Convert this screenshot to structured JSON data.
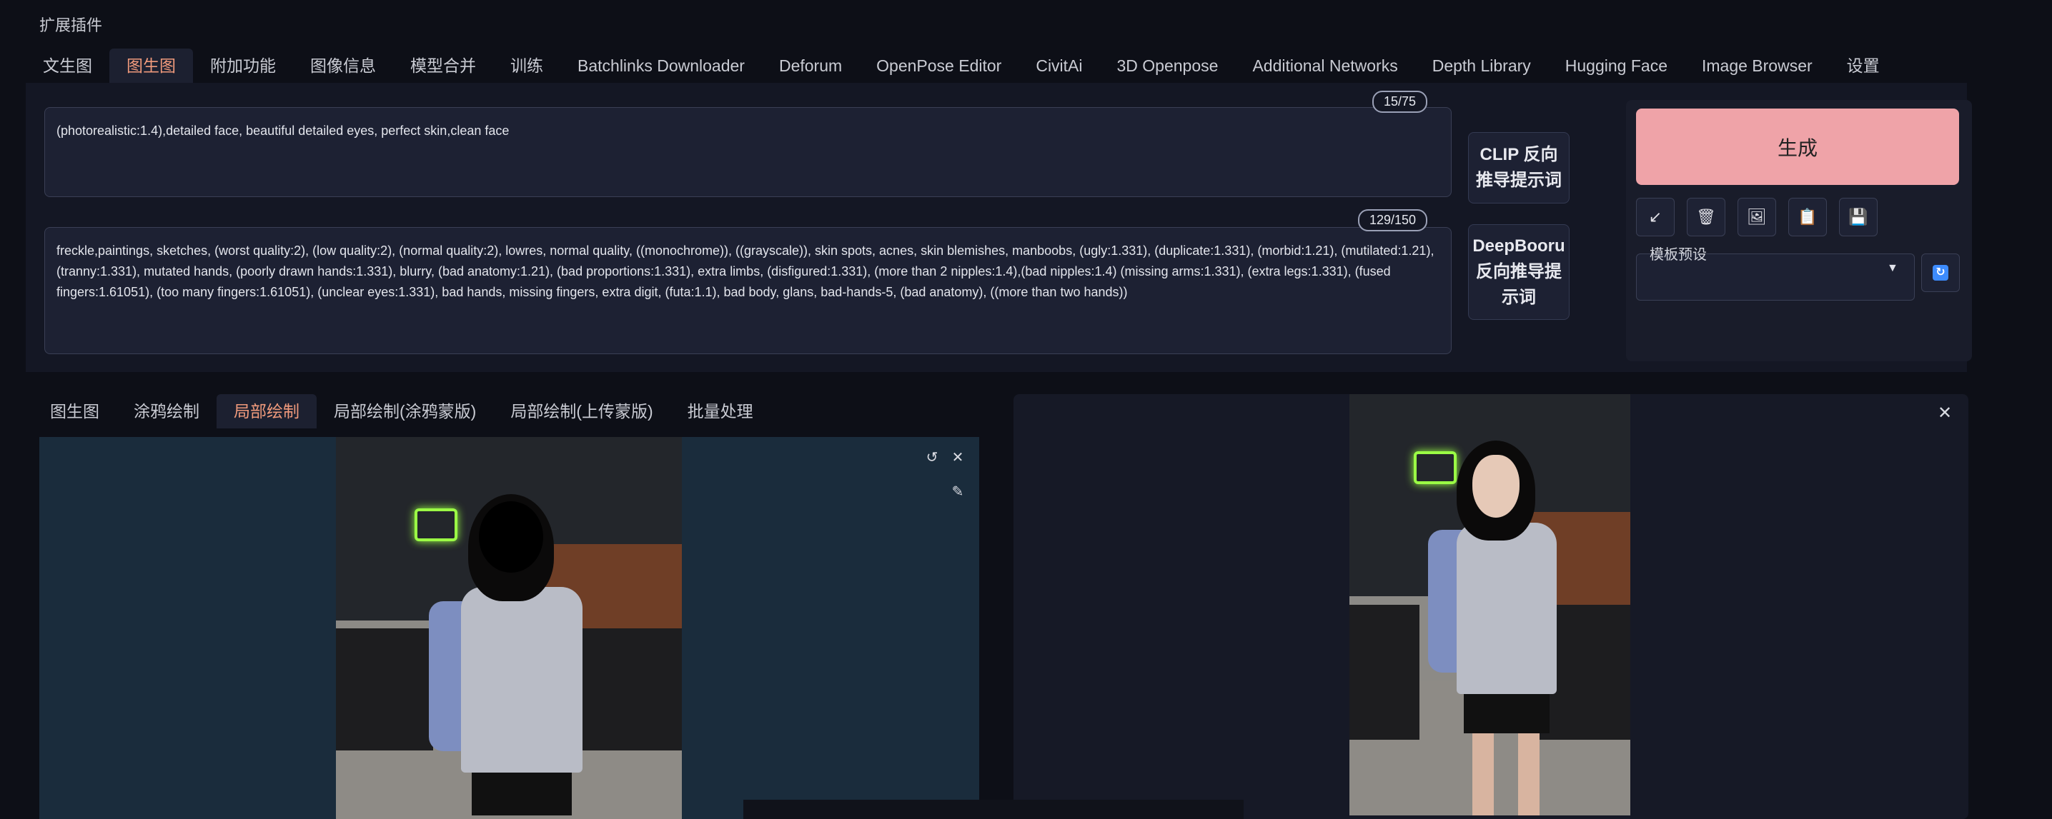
{
  "app": {
    "section_title": "扩展插件"
  },
  "main_tabs": [
    {
      "label": "文生图",
      "active": false
    },
    {
      "label": "图生图",
      "active": true
    },
    {
      "label": "附加功能",
      "active": false
    },
    {
      "label": "图像信息",
      "active": false
    },
    {
      "label": "模型合并",
      "active": false
    },
    {
      "label": "训练",
      "active": false
    },
    {
      "label": "Batchlinks Downloader",
      "active": false
    },
    {
      "label": "Deforum",
      "active": false
    },
    {
      "label": "OpenPose Editor",
      "active": false
    },
    {
      "label": "CivitAi",
      "active": false
    },
    {
      "label": "3D Openpose",
      "active": false
    },
    {
      "label": "Additional Networks",
      "active": false
    },
    {
      "label": "Depth Library",
      "active": false
    },
    {
      "label": "Hugging Face",
      "active": false
    },
    {
      "label": "Image Browser",
      "active": false
    },
    {
      "label": "设置",
      "active": false
    }
  ],
  "prompt": {
    "positive": "(photorealistic:1.4),detailed face, beautiful detailed eyes, perfect skin,clean face",
    "positive_counter": "15/75",
    "negative": "freckle,paintings, sketches, (worst quality:2), (low quality:2), (normal quality:2), lowres, normal quality, ((monochrome)), ((grayscale)), skin spots, acnes, skin blemishes, manboobs, (ugly:1.331), (duplicate:1.331), (morbid:1.21), (mutilated:1.21), (tranny:1.331), mutated hands, (poorly drawn hands:1.331), blurry, (bad anatomy:1.21), (bad proportions:1.331), extra limbs, (disfigured:1.331), (more than 2 nipples:1.4),(bad nipples:1.4) (missing arms:1.331), (extra legs:1.331), (fused fingers:1.61051), (too many fingers:1.61051), (unclear eyes:1.331), bad hands, missing fingers, extra digit, (futa:1.1), bad body, glans, bad-hands-5, (bad anatomy), ((more than two hands))",
    "negative_counter": "129/150"
  },
  "interrogate": {
    "clip_label": "CLIP 反向推导提示词",
    "deepbooru_label": "DeepBooru 反向推导提示词"
  },
  "actions": {
    "generate_label": "生成",
    "tools": [
      {
        "icon": "arrow-icon",
        "glyph": "↙"
      },
      {
        "icon": "trash-icon",
        "glyph": "🗑"
      },
      {
        "icon": "image-icon",
        "glyph": "🖼"
      },
      {
        "icon": "clipboard-icon",
        "glyph": "📋"
      },
      {
        "icon": "save-icon",
        "glyph": "💾"
      }
    ],
    "style_preset_label": "模板预设",
    "style_preset_value": ""
  },
  "sub_tabs": [
    {
      "label": "图生图",
      "active": false
    },
    {
      "label": "涂鸦绘制",
      "active": false
    },
    {
      "label": "局部绘制",
      "active": true
    },
    {
      "label": "局部绘制(涂鸦蒙版)",
      "active": false
    },
    {
      "label": "局部绘制(上传蒙版)",
      "active": false
    },
    {
      "label": "批量处理",
      "active": false
    }
  ],
  "canvas": {
    "undo_glyph": "↺",
    "close_glyph": "✕",
    "brush_glyph": "✎"
  },
  "output": {
    "close_glyph": "✕"
  },
  "colors": {
    "accent_tab": "#f09a7c",
    "generate_bg": "#efa3a8",
    "refresh": "#3d8bfd"
  }
}
